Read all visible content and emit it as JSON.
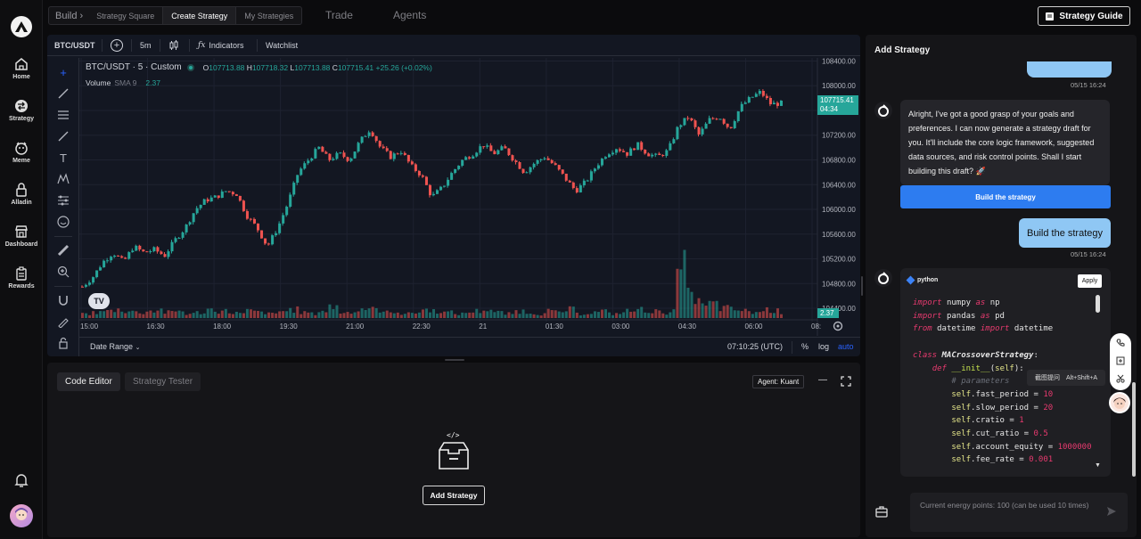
{
  "sidebar": {
    "logo": "A",
    "items": [
      {
        "label": "Home",
        "icon": "home-icon"
      },
      {
        "label": "Strategy",
        "icon": "strategy-icon"
      },
      {
        "label": "Meme",
        "icon": "meme-icon"
      },
      {
        "label": "Alladin",
        "icon": "lock-icon"
      },
      {
        "label": "Dashboard",
        "icon": "store-icon"
      },
      {
        "label": "Rewards",
        "icon": "clipboard-icon"
      }
    ]
  },
  "topbar": {
    "build": "Build",
    "build_chevron": "›",
    "tabs": [
      "Strategy Square",
      "Create Strategy",
      "My Strategies"
    ],
    "active_tab": "Create Strategy",
    "nav": [
      "Trade",
      "Agents"
    ],
    "guide": "Strategy Guide"
  },
  "chart": {
    "toolbar": {
      "symbol": "BTC/USDT",
      "plus": "+",
      "interval": "5m",
      "indicators": "Indicators",
      "watchlist": "Watchlist"
    },
    "legend": {
      "title": "BTC/USDT · 5 · Custom",
      "o_label": "O",
      "o": "107713.88",
      "h_label": "H",
      "h": "107718.32",
      "l_label": "L",
      "l": "107713.88",
      "c_label": "C",
      "c": "107715.41",
      "change": "+25.26 (+0.02%)",
      "volume": "Volume",
      "sma": "SMA 9",
      "sma_value": "2.37"
    },
    "price_label": {
      "price": "107715.41",
      "countdown": "04:34"
    },
    "volume_label": "2.37",
    "bottom": {
      "date_range": "Date Range",
      "time": "07:10:25 (UTC)",
      "pct": "%",
      "log": "log",
      "auto": "auto"
    },
    "logo_text": "TV"
  },
  "chart_data": {
    "type": "candlestick",
    "title": "BTC/USDT · 5 · Custom",
    "y_ticks": [
      "108400.00",
      "108000.00",
      "107600.00",
      "107200.00",
      "106800.00",
      "106400.00",
      "106000.00",
      "105600.00",
      "105200.00",
      "104800.00",
      "104400.00"
    ],
    "ylim": [
      104300,
      108450
    ],
    "x_ticks": [
      "15:00",
      "16:30",
      "18:00",
      "19:30",
      "21:00",
      "22:30",
      "21",
      "01:30",
      "03:00",
      "04:30",
      "06:00",
      "08:"
    ],
    "close_path": [
      104750,
      104900,
      105150,
      105300,
      105150,
      105400,
      105300,
      105350,
      105250,
      105500,
      105700,
      106000,
      106150,
      106200,
      106300,
      106250,
      105900,
      105700,
      105400,
      105700,
      106100,
      106600,
      106800,
      107000,
      106800,
      106900,
      106800,
      107100,
      107300,
      107000,
      106850,
      106950,
      106700,
      106550,
      106200,
      106350,
      106600,
      106800,
      106900,
      107050,
      106900,
      107000,
      106800,
      106600,
      106750,
      106850,
      106700,
      106500,
      106300,
      106450,
      106700,
      106900,
      107000,
      106900,
      107050,
      106900,
      106850,
      106950,
      107350,
      107500,
      107200,
      107450,
      107500,
      107300,
      107650,
      107800,
      107900,
      107700,
      107715
    ],
    "volume_path": [
      0.3,
      0.4,
      0.5,
      0.6,
      0.5,
      0.4,
      0.5,
      0.6,
      0.4,
      0.5,
      0.3,
      0.4,
      0.6,
      0.5,
      0.4,
      0.3,
      0.5,
      0.4,
      0.3,
      0.5,
      0.6,
      0.4,
      0.3,
      0.5,
      0.8,
      0.4,
      0.5,
      0.7,
      0.6,
      0.4,
      0.5,
      0.3,
      0.4,
      0.6,
      0.5,
      0.4,
      0.3,
      0.4,
      0.5,
      0.6,
      0.4,
      0.3,
      0.5,
      0.4,
      0.3,
      0.5,
      0.4,
      0.6,
      0.3,
      0.4,
      0.5,
      0.3,
      0.4,
      0.5,
      0.6,
      0.5,
      0.4,
      0.5,
      3.5,
      1.4,
      0.8,
      1.0,
      0.7,
      0.6,
      0.5,
      0.4,
      0.6,
      0.5,
      0.4
    ]
  },
  "code_panel": {
    "tabs": [
      "Code Editor",
      "Strategy Tester"
    ],
    "agent": "Agent: Kuant",
    "minimize": "—",
    "add_strategy": "Add Strategy",
    "code_glyph": "</>"
  },
  "assistant": {
    "header": "Add Strategy",
    "ts1": "05/15 16:24",
    "bot_message": "Alright, I've got a good grasp of your goals and preferences. I can now generate a strategy draft for you. It'll include the core logic framework, suggested data sources, and risk control points. Shall I start building this draft? 🚀",
    "build_button": "Build the strategy",
    "user_message": "Build the strategy",
    "ts2": "05/15 16:24",
    "code_lang": "python",
    "apply": "Apply",
    "tooltip": "截图提问",
    "tooltip_shortcut": "Alt+Shift+A",
    "input_placeholder": "Current energy points: 100 (can be used 10 times)"
  }
}
